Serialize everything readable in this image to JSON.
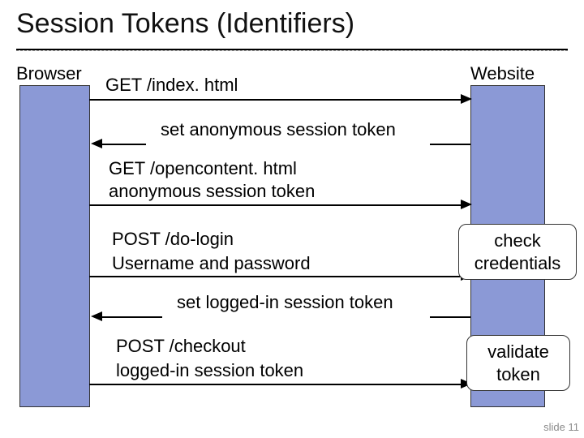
{
  "title": "Session Tokens (Identifiers)",
  "left_actor": "Browser",
  "right_actor": "Website",
  "messages": {
    "m1": "GET /index. html",
    "m2": "set anonymous session token",
    "m3a": "GET /opencontent. html",
    "m3b": "anonymous session token",
    "m4a": "POST /do-login",
    "m4b": "Username and password",
    "m5": "set logged-in session token",
    "m6a": "POST /checkout",
    "m6b": "logged-in session token"
  },
  "boxes": {
    "b1a": "check",
    "b1b": "credentials",
    "b2a": "validate",
    "b2b": "token"
  },
  "slide_number": "slide 11"
}
